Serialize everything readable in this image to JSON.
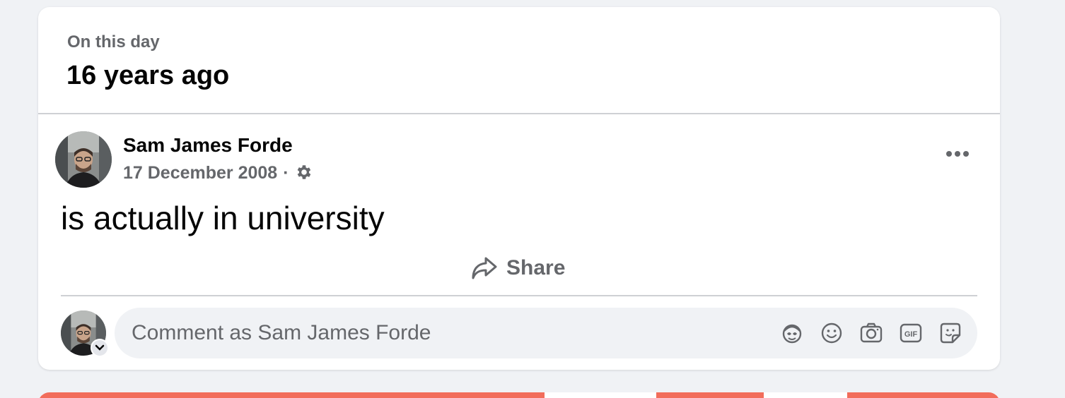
{
  "memory": {
    "eyebrow": "On this day",
    "headline": "16 years ago"
  },
  "post": {
    "author": "Sam James Forde",
    "date": "17 December 2008",
    "separator": "·",
    "audience_icon": "gear-icon",
    "text": "is actually in university",
    "more_icon": "more-options-icon"
  },
  "actions": {
    "share_label": "Share",
    "share_icon": "share-arrow-icon"
  },
  "comment": {
    "placeholder": "Comment as Sam James Forde",
    "tools": [
      "avatar-sticker-icon",
      "emoji-icon",
      "camera-icon",
      "gif-icon",
      "sticker-icon"
    ]
  },
  "colors": {
    "page_bg": "#f0f2f5",
    "card_bg": "#ffffff",
    "secondary_text": "#65676b",
    "primary_text": "#050505",
    "next_card_accent": "#f26d5b"
  }
}
